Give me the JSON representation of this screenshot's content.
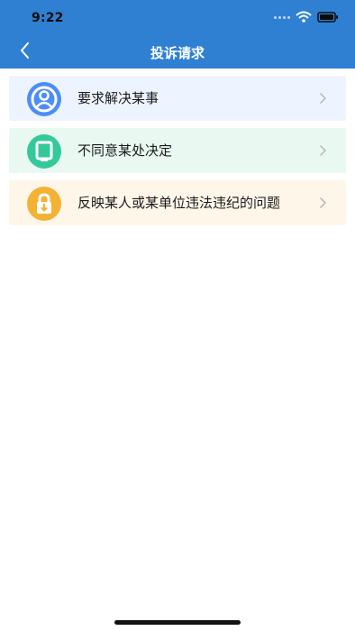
{
  "status_bar": {
    "time": "9:22",
    "icons": [
      "signal-dots-icon",
      "wifi-icon",
      "battery-icon"
    ]
  },
  "nav": {
    "back_icon": "chevron-left-icon",
    "title": "投诉请求"
  },
  "list": {
    "items": [
      {
        "label": "要求解决某事",
        "icon": "person-circle-icon",
        "accent": "#4c8df6",
        "bg": "#eef4ff"
      },
      {
        "label": "不同意某处决定",
        "icon": "tablet-icon",
        "accent": "#34c99a",
        "bg": "#e9f9f2"
      },
      {
        "label": "反映某人或某单位违法违纪的问题",
        "icon": "lock-icon",
        "accent": "#f4b234",
        "bg": "#fff6ea"
      }
    ]
  },
  "colors": {
    "header": "#2f80d2",
    "chevron": "#bdbdbd",
    "text": "#1b1b1b"
  }
}
